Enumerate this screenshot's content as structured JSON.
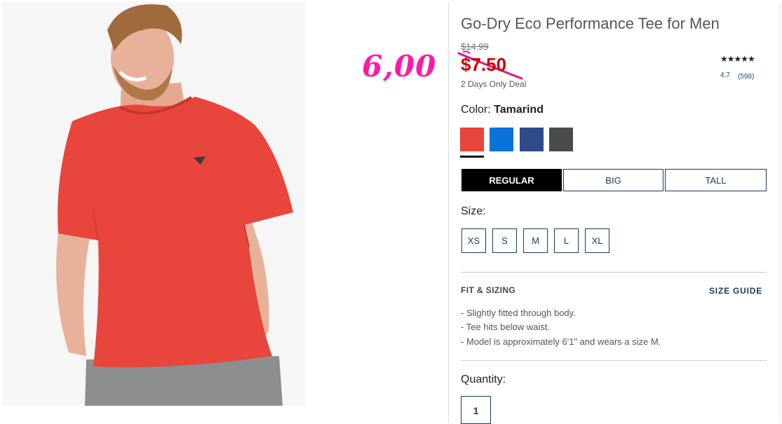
{
  "annotation": {
    "handwritten_price": "6,00",
    "color": "#ff1aa6"
  },
  "product": {
    "title": "Go-Dry Eco Performance Tee for Men",
    "original_price": "$14.99",
    "sale_price": "$7.50",
    "deal_note": "2 Days Only Deal",
    "stars": "★★★★★",
    "rating": "4.7",
    "review_count": "(598)"
  },
  "color": {
    "label": "Color:",
    "selected": "Tamarind",
    "swatches": [
      {
        "name": "tamarind",
        "hex": "#e8453c",
        "selected": true
      },
      {
        "name": "blue",
        "hex": "#0a73d9",
        "selected": false
      },
      {
        "name": "navy",
        "hex": "#2f4b8a",
        "selected": false
      },
      {
        "name": "charcoal",
        "hex": "#4a4b4d",
        "selected": false
      }
    ]
  },
  "fit_options": [
    {
      "label": "REGULAR",
      "active": true
    },
    {
      "label": "BIG",
      "active": false
    },
    {
      "label": "TALL",
      "active": false
    }
  ],
  "size": {
    "label": "Size:",
    "options": [
      "XS",
      "S",
      "M",
      "L",
      "XL"
    ]
  },
  "fit_sizing": {
    "title": "FIT & SIZING",
    "guide_link": "SIZE GUIDE",
    "bullets": [
      "-  Slightly fitted through body.",
      "-  Tee hits below waist.",
      "-  Model is approximately 6'1\" and wears a size M."
    ]
  },
  "quantity": {
    "label": "Quantity:",
    "value": "1"
  },
  "colors": {
    "sale_red": "#cc0000",
    "navy_text": "#1b3a5c",
    "shirt_red": "#e8453c"
  }
}
